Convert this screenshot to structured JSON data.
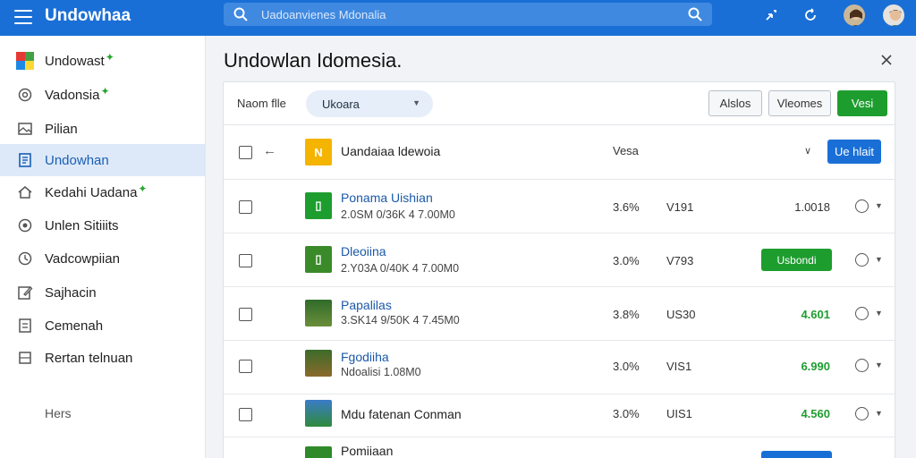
{
  "app": {
    "title": "Undowhaa"
  },
  "search": {
    "placeholder": "Uadoanvienes Mdonalia"
  },
  "sidebar": {
    "items": [
      {
        "label": "Undowast",
        "star": true,
        "icon": "app-logo-icon"
      },
      {
        "label": "Vadonsia",
        "star": true,
        "icon": "settings-icon"
      },
      {
        "label": "Pilian",
        "star": false,
        "icon": "image-icon"
      },
      {
        "label": "Undowhan",
        "star": false,
        "icon": "document-icon"
      },
      {
        "label": "Kedahi Uadana",
        "star": true,
        "icon": "home-icon"
      },
      {
        "label": "Unlen Sitiiits",
        "star": false,
        "icon": "target-icon"
      },
      {
        "label": "Vadcowpiian",
        "star": false,
        "icon": "location-icon"
      },
      {
        "label": "Sajhacin",
        "star": false,
        "icon": "edit-icon"
      },
      {
        "label": "Cemenah",
        "star": false,
        "icon": "note-icon"
      },
      {
        "label": "Rertan telnuan",
        "star": false,
        "icon": "grid-icon"
      }
    ],
    "footer": "Hers"
  },
  "main": {
    "title": "Undowlan Idomesia.",
    "filter": {
      "label": "Naom flle",
      "select_value": "Ukoara",
      "btn_a": "Alslos",
      "btn_b": "Vleomes",
      "btn_primary": "Vesi"
    },
    "header": {
      "title": "Uandaiaa ldewoia",
      "col": "Vesa",
      "button": "Ue hlait",
      "thumb_letter": "N"
    },
    "rows": [
      {
        "name": "Ponama Uishian",
        "sub": "2.0SM 0/36K 4 7.00M0",
        "pct": "3.6%",
        "code": "V191",
        "value": "1.0018",
        "green": false,
        "button": ""
      },
      {
        "name": "Dleoiina",
        "sub": "2.Y03A 0/40K 4 7.00M0",
        "pct": "3.0%",
        "code": "V793",
        "value": "",
        "green": false,
        "button": "Usbondi"
      },
      {
        "name": "Papalilas",
        "sub": "3.SK14 9/50K 4 7.45M0",
        "pct": "3.8%",
        "code": "US30",
        "value": "4.601",
        "green": true,
        "button": ""
      },
      {
        "name": "Fgodiiha",
        "sub": "Ndoalisi 1.08M0",
        "pct": "3.0%",
        "code": "VIS1",
        "value": "6.990",
        "green": true,
        "button": ""
      },
      {
        "name": "Mdu fatenan Conman",
        "sub": "",
        "pct": "3.0%",
        "code": "UIS1",
        "value": "4.560",
        "green": true,
        "button": ""
      },
      {
        "name": "Pomiiaan",
        "sub": "",
        "pct": "",
        "code": "",
        "value": "",
        "green": false,
        "button": ""
      }
    ]
  },
  "colors": {
    "topbar": "#1a6fd6",
    "accent_green": "#1e9d2f",
    "active_item": "#dde9f8"
  }
}
